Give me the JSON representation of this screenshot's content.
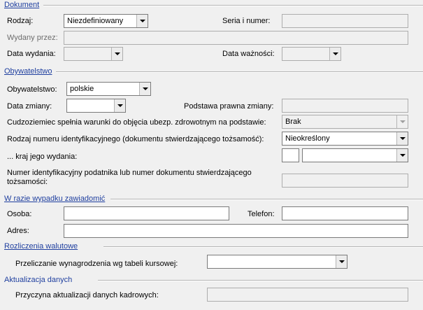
{
  "dokument": {
    "title": "Dokument",
    "rodzaj_label": "Rodzaj:",
    "rodzaj_value": "Niezdefiniowany",
    "seria_label": "Seria i numer:",
    "wydany_label": "Wydany przez:",
    "data_wydania_label": "Data wydania:",
    "data_waznosci_label": "Data ważności:"
  },
  "obywatelstwo": {
    "title": "Obywatelstwo",
    "obywatelstwo_label": "Obywatelstwo:",
    "obywatelstwo_value": "polskie",
    "data_zmiany_label": "Data zmiany:",
    "podstawa_label": "Podstawa prawna zmiany:",
    "cudzoziemiec_label": "Cudzoziemiec spełnia warunki do objęcia ubezp. zdrowotnym na podstawie:",
    "cudzoziemiec_value": "Brak",
    "rodzaj_numeru_label": "Rodzaj numeru identyfikacyjnego (dokumentu stwierdzającego tożsamość):",
    "rodzaj_numeru_value": "Nieokreślony",
    "kraj_label": "... kraj jego wydania:",
    "numer_label_line1": "Numer identyfikacyjny podatnika lub numer dokumentu stwierdzającego",
    "numer_label_line2": "tożsamości:"
  },
  "wypadek": {
    "title": "W razie wypadku zawiadomić",
    "osoba_label": "Osoba:",
    "telefon_label": "Telefon:",
    "adres_label": "Adres:"
  },
  "rozliczenia": {
    "title": "Rozliczenia walutowe",
    "przeliczanie_label": "Przeliczanie wynagrodzenia wg tabeli kursowej:"
  },
  "aktualizacja": {
    "title": "Aktualizacja danych",
    "przyczyna_label": "Przyczyna aktualizacji danych kadrowych:"
  }
}
